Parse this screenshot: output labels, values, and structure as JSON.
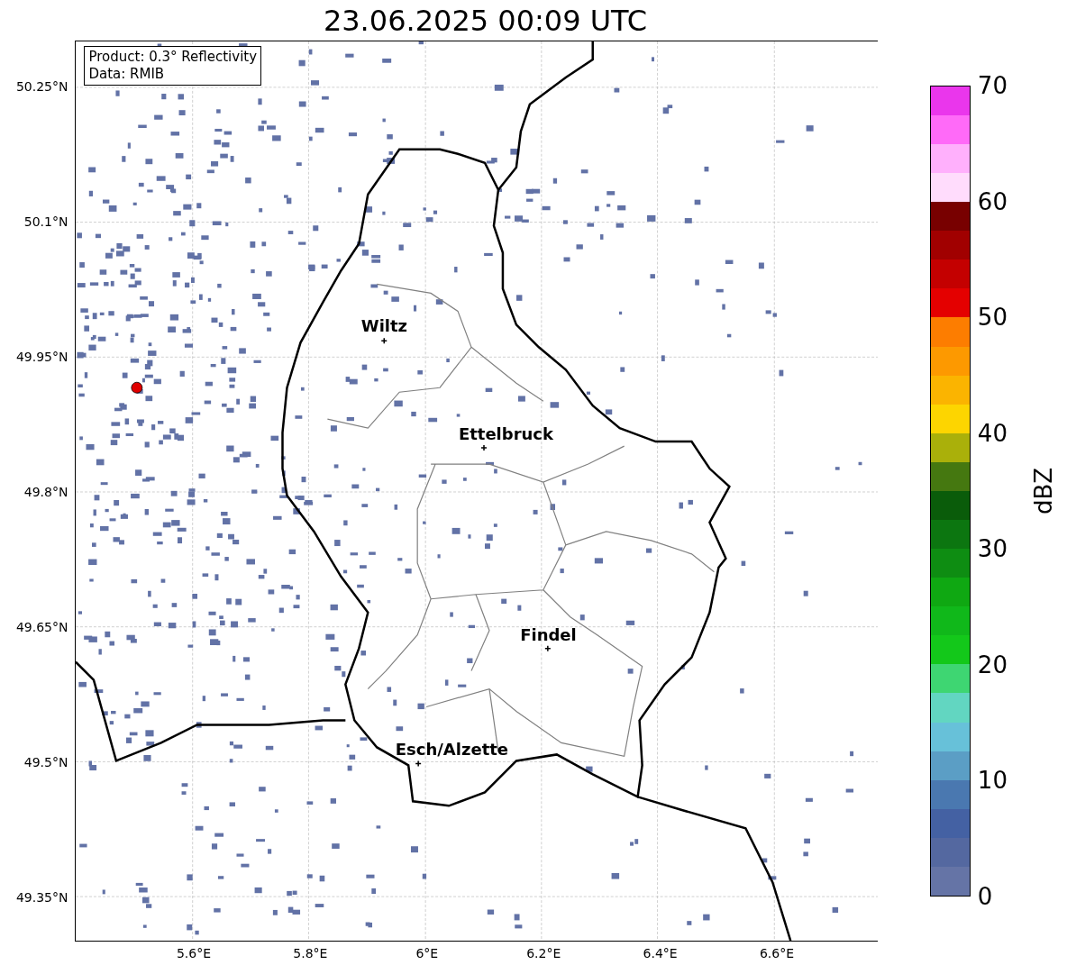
{
  "title": "23.06.2025 00:09 UTC",
  "info_box": [
    "Product: 0.3° Reflectivity",
    "Data: RMIB"
  ],
  "cities": [
    {
      "name": "Wiltz"
    },
    {
      "name": "Ettelbruck"
    },
    {
      "name": "Findel"
    },
    {
      "name": "Esch/Alzette"
    }
  ],
  "x_ticks": [
    "5.6°E",
    "5.8°E",
    "6°E",
    "6.2°E",
    "6.4°E",
    "6.6°E"
  ],
  "y_ticks": [
    "50.25°N",
    "50.1°N",
    "49.95°N",
    "49.8°N",
    "49.65°N",
    "49.5°N",
    "49.35°N"
  ],
  "colorbar": {
    "label": "dBZ",
    "ticks": [
      "70",
      "60",
      "50",
      "40",
      "30",
      "20",
      "10",
      "0"
    ],
    "segments": [
      {
        "color": "#6574a6"
      },
      {
        "color": "#5468a0"
      },
      {
        "color": "#4461a3"
      },
      {
        "color": "#4a78b0"
      },
      {
        "color": "#5b9ec5"
      },
      {
        "color": "#67c1d9"
      },
      {
        "color": "#62d6c1"
      },
      {
        "color": "#3ed672"
      },
      {
        "color": "#13c81a"
      },
      {
        "color": "#10b81a"
      },
      {
        "color": "#0fa812"
      },
      {
        "color": "#0e8d12"
      },
      {
        "color": "#0c7610"
      },
      {
        "color": "#0a5c0a"
      },
      {
        "color": "#457810"
      },
      {
        "color": "#aab00a"
      },
      {
        "color": "#fdd500"
      },
      {
        "color": "#fbb400"
      },
      {
        "color": "#fd9900"
      },
      {
        "color": "#fd7d00"
      },
      {
        "color": "#e40000"
      },
      {
        "color": "#c40000"
      },
      {
        "color": "#a10000"
      },
      {
        "color": "#780000"
      },
      {
        "color": "#ffdcfc"
      },
      {
        "color": "#ffb0fc"
      },
      {
        "color": "#ff6af8"
      },
      {
        "color": "#ea36ec"
      }
    ]
  }
}
